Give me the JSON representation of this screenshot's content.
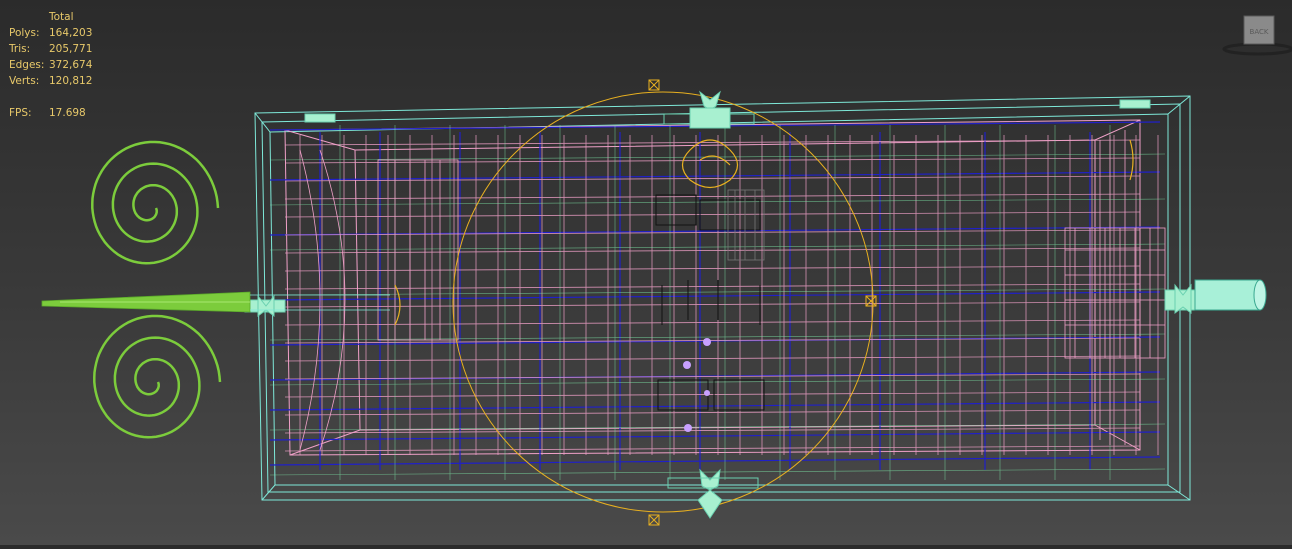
{
  "stats": {
    "header": "Total",
    "rows": [
      {
        "label": "Polys:",
        "value": "164,203"
      },
      {
        "label": "Tris:",
        "value": "205,771"
      },
      {
        "label": "Edges:",
        "value": "372,674"
      },
      {
        "label": "Verts:",
        "value": "120,812"
      }
    ],
    "fps_label": "FPS:",
    "fps_value": "17.698"
  },
  "viewcube": {
    "face_label": "BACK"
  },
  "colors": {
    "stats_text": "#e8c96a",
    "wire_cyan": "#7ee8d8",
    "wire_pink": "#f0a0c8",
    "wire_blue": "#2020c8",
    "wire_green": "#7ccc3c",
    "gizmo_orange": "#e8b020",
    "light_mint": "#a8f0d0"
  }
}
